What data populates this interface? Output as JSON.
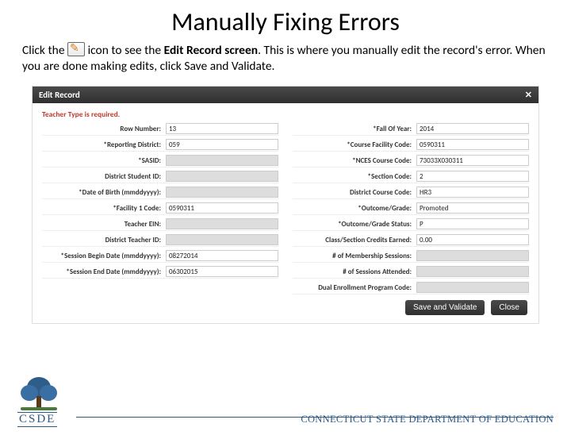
{
  "title": "Manually Fixing Errors",
  "intro": {
    "pre": "Click the ",
    "post_icon": " icon to see the ",
    "bold": "Edit Record screen",
    "rest": ". This is where you manually edit the record's error. When you are done making edits, click Save and Validate."
  },
  "dialog": {
    "title": "Edit Record",
    "close": "✕",
    "validation": "Teacher Type is required.",
    "left": [
      {
        "label": "Row Number:",
        "value": "13"
      },
      {
        "label": "*Reporting District:",
        "value": "059"
      },
      {
        "label": "*SASID:",
        "value": ""
      },
      {
        "label": "District Student ID:",
        "value": ""
      },
      {
        "label": "*Date of Birth (mmddyyyy):",
        "value": ""
      },
      {
        "label": "*Facility 1 Code:",
        "value": "0590311"
      },
      {
        "label": "Teacher EIN:",
        "value": ""
      },
      {
        "label": "District Teacher ID:",
        "value": ""
      },
      {
        "label": "*Session Begin Date (mmddyyyy):",
        "value": "08272014"
      },
      {
        "label": "*Session End Date (mmddyyyy):",
        "value": "06302015"
      }
    ],
    "right": [
      {
        "label": "*Fall Of Year:",
        "value": "2014"
      },
      {
        "label": "*Course Facility Code:",
        "value": "0590311"
      },
      {
        "label": "*NCES Course Code:",
        "value": "73033X030311"
      },
      {
        "label": "*Section Code:",
        "value": "2"
      },
      {
        "label": "District Course Code:",
        "value": "HR3"
      },
      {
        "label": "*Outcome/Grade:",
        "value": "Promoted"
      },
      {
        "label": "*Outcome/Grade Status:",
        "value": "P"
      },
      {
        "label": "Class/Section Credits Earned:",
        "value": "0.00"
      },
      {
        "label": "# of Membership Sessions:",
        "value": ""
      },
      {
        "label": "# of Sessions Attended:",
        "value": ""
      },
      {
        "label": "Dual Enrollment Program Code:",
        "value": ""
      }
    ],
    "buttons": {
      "save": "Save and Validate",
      "close": "Close"
    }
  },
  "footer": {
    "logo_text": "CSDE",
    "org": "CONNECTICUT STATE DEPARTMENT OF EDUCATION"
  }
}
